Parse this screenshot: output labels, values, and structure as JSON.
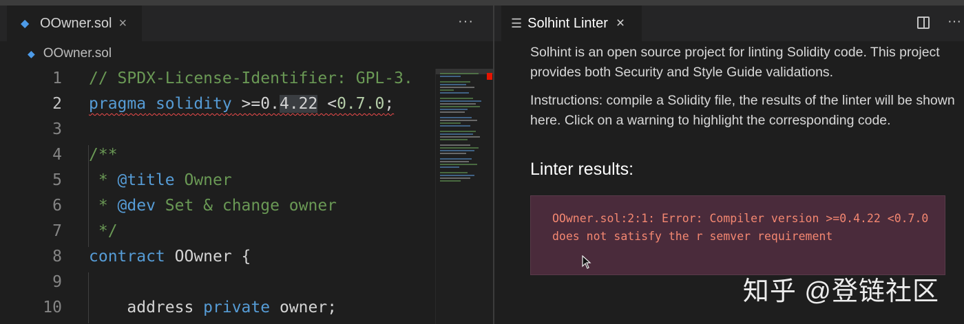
{
  "left_editor": {
    "tab": {
      "icon": "ethereum-icon",
      "label": "OOwner.sol",
      "close": "×"
    },
    "more": "···",
    "breadcrumb": {
      "icon": "ethereum-icon",
      "label": "OOwner.sol"
    },
    "lines": [
      {
        "num": "1",
        "parts": [
          {
            "t": "// SPDX-License-Identifier: GPL-3.",
            "c": "cm"
          }
        ]
      },
      {
        "num": "2",
        "current": true,
        "parts": [
          {
            "t": "pragma",
            "c": "kw sq"
          },
          {
            "t": " ",
            "c": "sq"
          },
          {
            "t": "solidity",
            "c": "kw sq"
          },
          {
            "t": " >=0.",
            "c": "sq"
          },
          {
            "t": "4.22",
            "c": "hl sq"
          },
          {
            "t": " <",
            "c": "sq"
          },
          {
            "t": "0.7.0",
            "c": "nm sq"
          },
          {
            "t": ";",
            "c": "sq"
          }
        ]
      },
      {
        "num": "3",
        "parts": []
      },
      {
        "num": "4",
        "parts": [
          {
            "t": "/**",
            "c": "cm"
          }
        ]
      },
      {
        "num": "5",
        "parts": [
          {
            "t": " * ",
            "c": "cm"
          },
          {
            "t": "@title",
            "c": "kw"
          },
          {
            "t": " Owner",
            "c": "cm"
          }
        ]
      },
      {
        "num": "6",
        "parts": [
          {
            "t": " * ",
            "c": "cm"
          },
          {
            "t": "@dev",
            "c": "kw"
          },
          {
            "t": " Set & change owner",
            "c": "cm"
          }
        ]
      },
      {
        "num": "7",
        "parts": [
          {
            "t": " */",
            "c": "cm"
          }
        ]
      },
      {
        "num": "8",
        "parts": [
          {
            "t": "contract",
            "c": "kw"
          },
          {
            "t": " OOwner {",
            "c": ""
          }
        ]
      },
      {
        "num": "9",
        "parts": []
      },
      {
        "num": "10",
        "parts": [
          {
            "t": "    address ",
            "c": ""
          },
          {
            "t": "private",
            "c": "kw"
          },
          {
            "t": " owner;",
            "c": ""
          }
        ]
      }
    ]
  },
  "right_panel": {
    "tab": {
      "icon": "preview-icon",
      "label": "Solhint Linter",
      "close": "×"
    },
    "split_icon": "split-editor-icon",
    "more": "···",
    "intro": "Solhint is an open source project for linting Solidity code. This project provides both Security and Style Guide validations.",
    "instructions": "Instructions: compile a Solidity file, the results of the linter will be shown here. Click on a warning to highlight the corresponding code.",
    "results_heading": "Linter results:",
    "error": "OOwner.sol:2:1: Error: Compiler version >=0.4.22 <0.7.0 does not satisfy the r semver requirement"
  },
  "watermark": "知乎 @登链社区"
}
